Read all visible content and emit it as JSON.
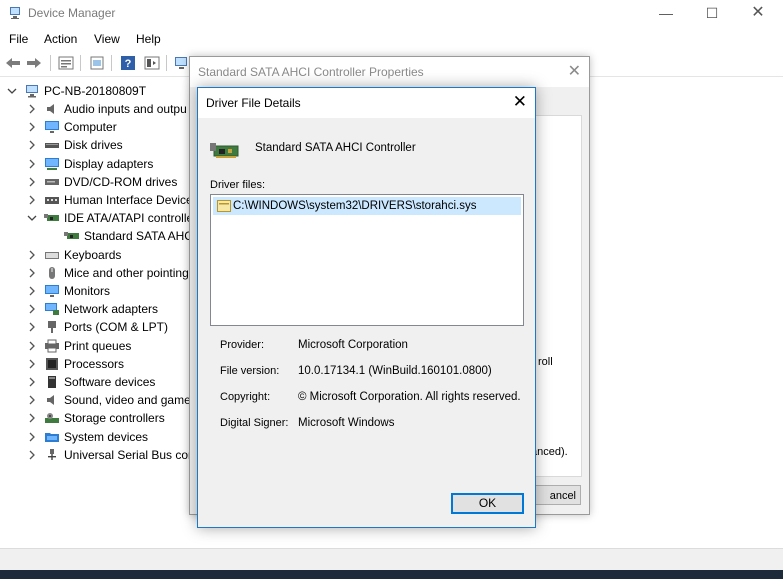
{
  "window": {
    "title": "Device Manager",
    "controls": {
      "minimize": "—",
      "maximize": "☐",
      "close": "✕"
    }
  },
  "menu": [
    "File",
    "Action",
    "View",
    "Help"
  ],
  "tree": {
    "root": "PC-NB-20180809T",
    "items": [
      {
        "label": "Audio inputs and outpu",
        "icon": "speaker-icon",
        "expanded": false
      },
      {
        "label": "Computer",
        "icon": "monitor-icon",
        "expanded": false
      },
      {
        "label": "Disk drives",
        "icon": "disk-icon",
        "expanded": false
      },
      {
        "label": "Display adapters",
        "icon": "display-adapter-icon",
        "expanded": false
      },
      {
        "label": "DVD/CD-ROM drives",
        "icon": "dvd-icon",
        "expanded": false
      },
      {
        "label": "Human Interface Device",
        "icon": "hid-icon",
        "expanded": false
      },
      {
        "label": "IDE ATA/ATAPI controlle",
        "icon": "controller-icon",
        "expanded": true
      },
      {
        "label": "Standard SATA AHCI",
        "icon": "controller-icon",
        "child": true
      },
      {
        "label": "Keyboards",
        "icon": "keyboard-icon",
        "expanded": false
      },
      {
        "label": "Mice and other pointing",
        "icon": "mouse-icon",
        "expanded": false
      },
      {
        "label": "Monitors",
        "icon": "monitor-icon",
        "expanded": false
      },
      {
        "label": "Network adapters",
        "icon": "network-icon",
        "expanded": false
      },
      {
        "label": "Ports (COM & LPT)",
        "icon": "port-icon",
        "expanded": false
      },
      {
        "label": "Print queues",
        "icon": "printer-icon",
        "expanded": false
      },
      {
        "label": "Processors",
        "icon": "cpu-icon",
        "expanded": false
      },
      {
        "label": "Software devices",
        "icon": "software-device-icon",
        "expanded": false
      },
      {
        "label": "Sound, video and game",
        "icon": "speaker-icon",
        "expanded": false
      },
      {
        "label": "Storage controllers",
        "icon": "storage-icon",
        "expanded": false
      },
      {
        "label": "System devices",
        "icon": "system-folder-icon",
        "expanded": false
      },
      {
        "label": "Universal Serial Bus cont",
        "icon": "usb-icon",
        "expanded": false
      }
    ]
  },
  "properties_dialog": {
    "title": "Standard SATA AHCI Controller Properties",
    "close": "✕",
    "partial_text_roll": "roll",
    "partial_text_anced": "anced).",
    "cancel_partial": "ancel"
  },
  "driver_dialog": {
    "title": "Driver File Details",
    "close": "✕",
    "device_name": "Standard SATA AHCI Controller",
    "files_label": "Driver files:",
    "files": [
      "C:\\WINDOWS\\system32\\DRIVERS\\storahci.sys"
    ],
    "details": [
      {
        "key": "Provider:",
        "value": "Microsoft Corporation"
      },
      {
        "key": "File version:",
        "value": "10.0.17134.1 (WinBuild.160101.0800)"
      },
      {
        "key": "Copyright:",
        "value": "© Microsoft Corporation. All rights reserved."
      },
      {
        "key": "Digital Signer:",
        "value": "Microsoft Windows"
      }
    ],
    "ok_label": "OK"
  },
  "colors": {
    "accent": "#0078d7",
    "selection": "#cce8ff",
    "taskbar": "#1d2a3a"
  }
}
